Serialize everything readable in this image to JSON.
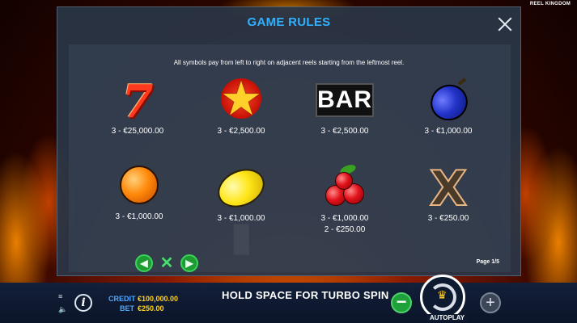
{
  "brand": "REEL KINGDOM",
  "rules_panel": {
    "title": "GAME RULES",
    "intro": "All symbols pay from left to right on adjacent reels starting from the leftmost reel.",
    "page_indicator": "Page 1/5",
    "symbols": [
      {
        "icon": "seven-icon",
        "lines": [
          "3 - €25,000.00"
        ]
      },
      {
        "icon": "star-icon",
        "lines": [
          "3 - €2,500.00"
        ]
      },
      {
        "icon": "bar-icon",
        "label": "BAR",
        "lines": [
          "3 - €2,500.00"
        ]
      },
      {
        "icon": "plum-icon",
        "lines": [
          "3 - €1,000.00"
        ]
      },
      {
        "icon": "orange-icon",
        "lines": [
          "3 - €1,000.00"
        ]
      },
      {
        "icon": "lemon-icon",
        "lines": [
          "3 - €1,000.00"
        ]
      },
      {
        "icon": "cherries-icon",
        "lines": [
          "3 - €1,000.00",
          "2 - €250.00"
        ]
      },
      {
        "icon": "x-symbol-icon",
        "label": "X",
        "lines": [
          "3 - €250.00"
        ]
      }
    ]
  },
  "bottom_bar": {
    "credit_label": "CREDIT",
    "credit_value": "€100,000.00",
    "bet_label": "BET",
    "bet_value": "€250.00",
    "turbo_text": "HOLD SPACE FOR TURBO SPIN",
    "autoplay_label": "AUTOPLAY"
  },
  "colors": {
    "title": "#2fb1ff",
    "credit_label": "#4ea8ff",
    "credit_value": "#ffd21e",
    "nav_green": "#1f9b34"
  }
}
